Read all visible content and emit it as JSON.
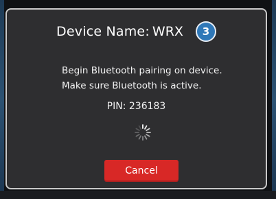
{
  "dialog": {
    "title_label": "Device Name:",
    "title_value": "WRX",
    "step_badge": "3",
    "message_line1": "Begin Bluetooth pairing on device.",
    "message_line2": "Make sure Bluetooth is active.",
    "pin_label": "PIN:",
    "pin_value": "236183",
    "cancel_label": "Cancel"
  },
  "icons": {
    "spinner": "loading-spinner-icon"
  },
  "colors": {
    "dialog_background": "#2e2e30",
    "dialog_border": "#c9c9c9",
    "badge": "#2f78b8",
    "cancel_button": "#d82826",
    "text": "#ffffff"
  }
}
